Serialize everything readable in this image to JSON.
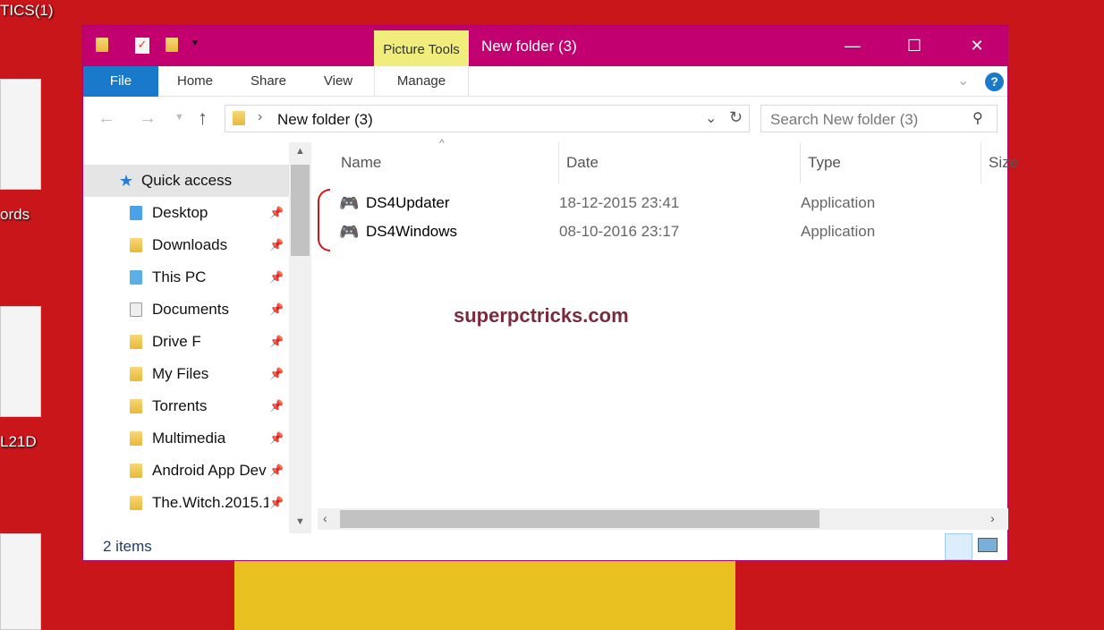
{
  "desktop": {
    "labels": [
      "TICS(1)",
      "ords",
      "L21D"
    ]
  },
  "window": {
    "title": "New folder (3)",
    "context_tab": "Picture Tools",
    "tabs": [
      "File",
      "Home",
      "Share",
      "View",
      "Manage"
    ],
    "controls": {
      "minimize": "—",
      "maximize": "☐",
      "close": "✕"
    },
    "address": {
      "path": "New folder (3)"
    },
    "search": {
      "placeholder": "Search New folder (3)"
    },
    "nav": {
      "quick_access": "Quick access",
      "items": [
        {
          "label": "Desktop",
          "icon": "desktop-icon"
        },
        {
          "label": "Downloads",
          "icon": "downloads-icon"
        },
        {
          "label": "This PC",
          "icon": "computer-icon"
        },
        {
          "label": "Documents",
          "icon": "documents-icon"
        },
        {
          "label": "Drive F",
          "icon": "folder-icon"
        },
        {
          "label": "My Files",
          "icon": "folder-icon"
        },
        {
          "label": "Torrents",
          "icon": "folder-icon"
        },
        {
          "label": "Multimedia",
          "icon": "folder-icon"
        },
        {
          "label": "Android App Dev",
          "icon": "folder-icon"
        },
        {
          "label": "The.Witch.2015.1",
          "icon": "folder-icon"
        }
      ]
    },
    "columns": [
      "Name",
      "Date",
      "Type",
      "Size"
    ],
    "files": [
      {
        "name": "DS4Updater",
        "date": "18-12-2015 23:41",
        "type": "Application"
      },
      {
        "name": "DS4Windows",
        "date": "08-10-2016 23:17",
        "type": "Application"
      }
    ],
    "watermark": "superpctricks.com",
    "status": "2 items"
  }
}
